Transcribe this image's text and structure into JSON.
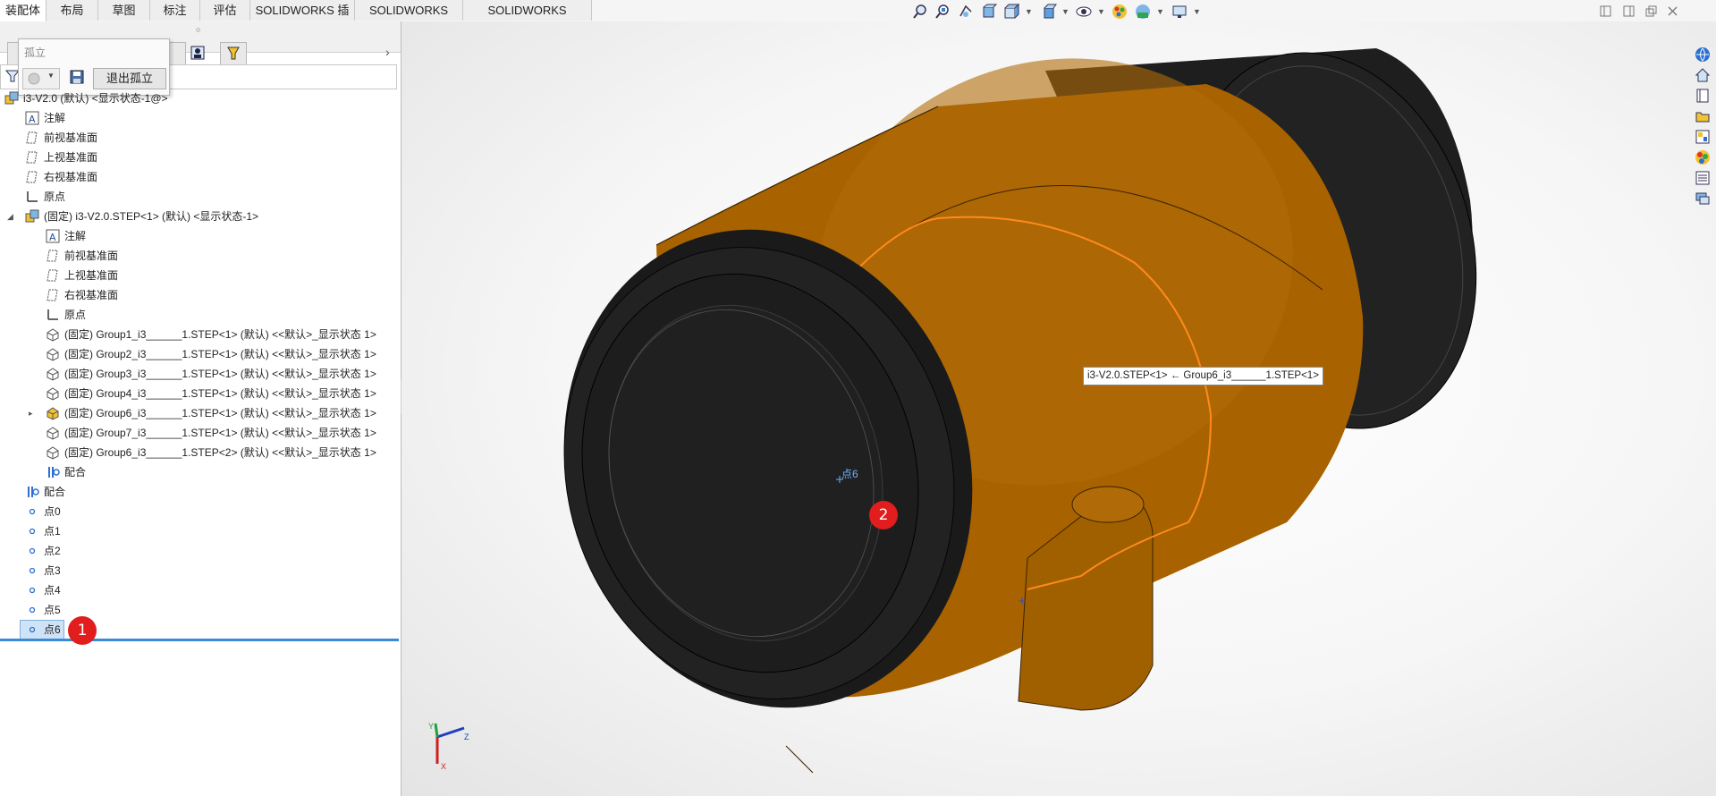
{
  "tabs": [
    "装配体",
    "布局",
    "草图",
    "标注",
    "评估",
    "SOLIDWORKS 插件",
    "SOLIDWORKS CAM",
    "SOLIDWORKS Inspection"
  ],
  "active_tab": "装配体",
  "isolate_popup": {
    "title": "孤立",
    "exit_label": "退出孤立"
  },
  "tree": {
    "root": "i3-V2.0 (默认) <显示状态-1@>",
    "root_children": [
      "注解",
      "前视基准面",
      "上视基准面",
      "右视基准面",
      "原点"
    ],
    "subassembly": "(固定) i3-V2.0.STEP<1> (默认) <显示状态-1>",
    "sub_children": [
      "注解",
      "前视基准面",
      "上视基准面",
      "右视基准面",
      "原点"
    ],
    "parts": [
      "(固定) Group1_i3______1.STEP<1> (默认) <<默认>_显示状态 1>",
      "(固定) Group2_i3______1.STEP<1> (默认) <<默认>_显示状态 1>",
      "(固定) Group3_i3______1.STEP<1> (默认) <<默认>_显示状态 1>",
      "(固定) Group4_i3______1.STEP<1> (默认) <<默认>_显示状态 1>",
      "(固定) Group6_i3______1.STEP<1> (默认) <<默认>_显示状态 1>",
      "(固定) Group7_i3______1.STEP<1> (默认) <<默认>_显示状态 1>",
      "(固定) Group6_i3______1.STEP<2> (默认) <<默认>_显示状态 1>"
    ],
    "sub_mates": "配合",
    "mates": "配合",
    "points": [
      "点0",
      "点1",
      "点2",
      "点3",
      "点4",
      "点5",
      "点6"
    ]
  },
  "viewport": {
    "tooltip": "i3-V2.0.STEP<1> ← Group6_i3______1.STEP<1>",
    "point_label": "点6",
    "axis_labels": {
      "x": "X",
      "y": "Y",
      "z": "Z"
    }
  },
  "badges": [
    "1",
    "2"
  ],
  "colors": {
    "orange": "#a86200",
    "black_body": "#1e1e1e",
    "highlight": "#ff8a1c",
    "selection": "#cfe3f7",
    "accent": "#3b8ad8",
    "badge": "#e11d1d"
  }
}
